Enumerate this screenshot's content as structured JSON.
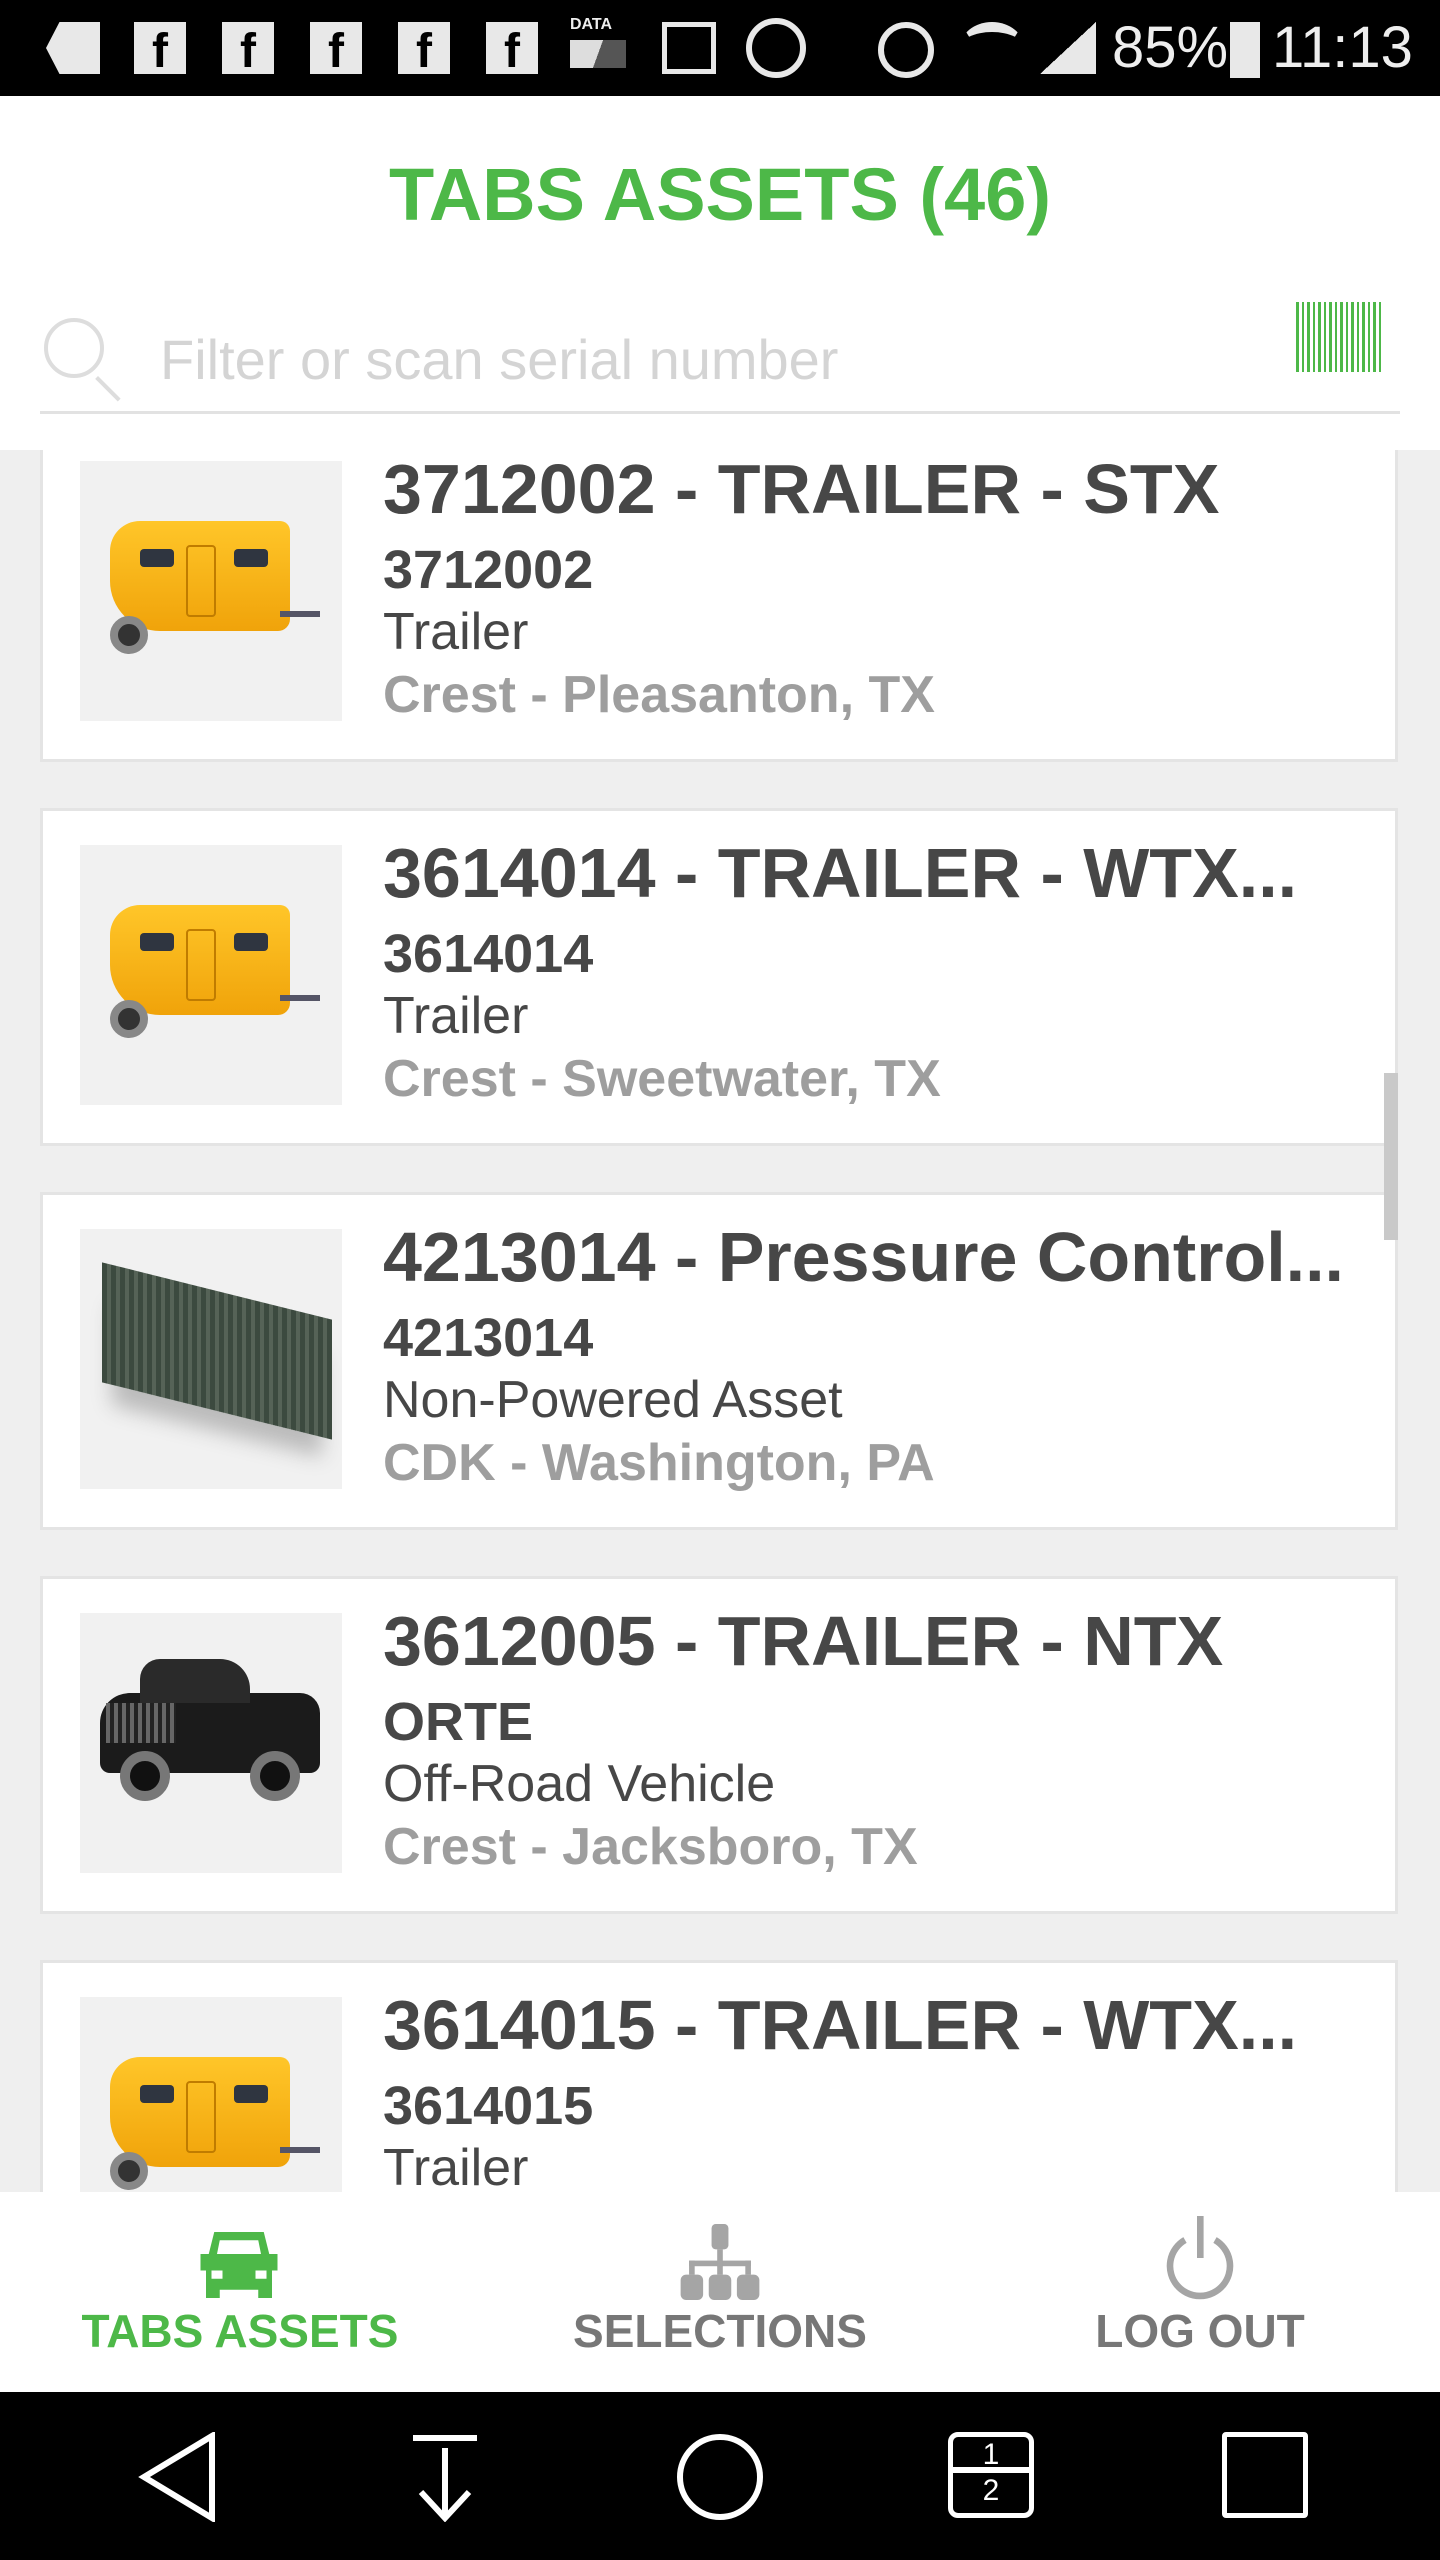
{
  "status_bar": {
    "icons": [
      "more-notifications-icon",
      "facebook-icon",
      "facebook-icon",
      "facebook-icon",
      "facebook-icon",
      "facebook-icon",
      "data-icon",
      "gallery-icon",
      "whatsapp-icon",
      "alarm-icon",
      "wifi-icon",
      "signal-icon",
      "battery-icon"
    ],
    "data_label": "DATA",
    "battery": "85%",
    "time": "11:13"
  },
  "header": {
    "title": "TABS ASSETS (46)",
    "search": {
      "placeholder": "Filter or scan serial number",
      "value": ""
    }
  },
  "assets": [
    {
      "title": "3712002 - TRAILER - STX",
      "serial": "3712002",
      "type": "Trailer",
      "location": "Crest - Pleasanton, TX",
      "image": "trailer"
    },
    {
      "title": "3614014 - TRAILER - WTX...",
      "serial": "3614014",
      "type": "Trailer",
      "location": "Crest - Sweetwater, TX",
      "image": "trailer"
    },
    {
      "title": "4213014 - Pressure Control...",
      "serial": "4213014",
      "type": "Non-Powered Asset",
      "location": "CDK - Washington, PA",
      "image": "container"
    },
    {
      "title": "3612005 - TRAILER - NTX",
      "serial": "ORTE",
      "type": "Off-Road Vehicle",
      "location": "Crest - Jacksboro, TX",
      "image": "pickup-truck"
    },
    {
      "title": "3614015 - TRAILER - WTX...",
      "serial": "3614015",
      "type": "Trailer",
      "location": "",
      "image": "trailer"
    }
  ],
  "scroll_position_percent": 55,
  "bottom_nav": {
    "items": [
      {
        "label": "TABS ASSETS",
        "icon": "car-icon",
        "active": true
      },
      {
        "label": "SELECTIONS",
        "icon": "hierarchy-icon",
        "active": false
      },
      {
        "label": "LOG OUT",
        "icon": "power-icon",
        "active": false
      }
    ]
  },
  "system_nav": {
    "buttons": [
      "back",
      "notification-pull",
      "home",
      "dual-window",
      "recents"
    ],
    "dual_window_labels": [
      "1",
      "2"
    ]
  },
  "colors": {
    "accent": "#4db848",
    "text": "#474747",
    "muted": "#9e9e9e"
  }
}
